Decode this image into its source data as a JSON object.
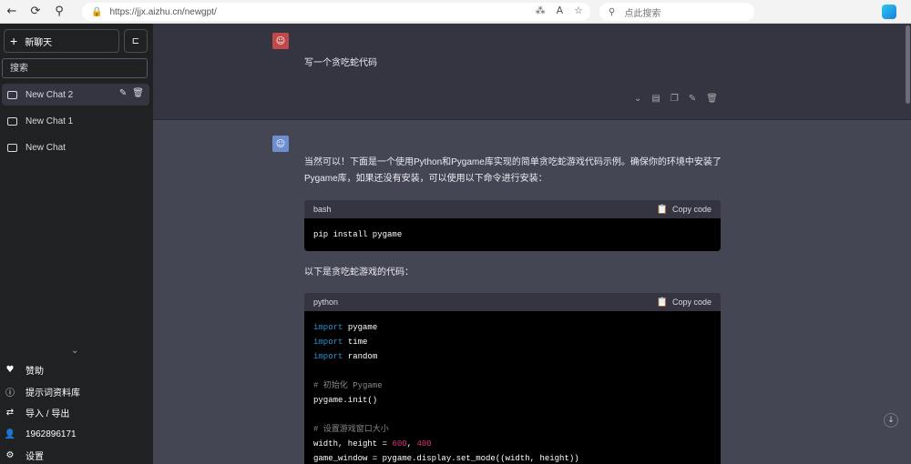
{
  "browser": {
    "url": "https://jjx.aizhu.cn/newgpt/",
    "search_placeholder": "点此搜索"
  },
  "sidebar": {
    "new_chat_label": "新聊天",
    "search_placeholder": "搜索",
    "chats": [
      {
        "label": "New Chat 2",
        "active": true
      },
      {
        "label": "New Chat 1",
        "active": false
      },
      {
        "label": "New Chat",
        "active": false
      }
    ],
    "bottom_items": [
      {
        "label": "赞助",
        "icon": "heart-icon"
      },
      {
        "label": "提示词资料库",
        "icon": "info-icon"
      },
      {
        "label": "导入 / 导出",
        "icon": "import-export-icon"
      },
      {
        "label": "1962896171",
        "icon": "user-icon"
      },
      {
        "label": "设置",
        "icon": "gear-icon"
      }
    ]
  },
  "conversation": {
    "user_message": "写一个贪吃蛇代码",
    "bot_intro": "当然可以！下面是一个使用Python和Pygame库实现的简单贪吃蛇游戏代码示例。确保你的环境中安装了Pygame库，如果还没有安装，可以使用以下命令进行安装：",
    "code1": {
      "lang": "bash",
      "copy_label": "Copy code",
      "line": "pip install pygame"
    },
    "bot_middle": "以下是贪吃蛇游戏的代码：",
    "code2": {
      "lang": "python",
      "copy_label": "Copy code",
      "kw_import": "import",
      "mod1": "pygame",
      "mod2": "time",
      "mod3": "random",
      "comment1": "# 初始化 Pygame",
      "init_line": "pygame.init()",
      "comment2": "# 设置游戏窗口大小",
      "wh_prefix": "width, height = ",
      "width_val": "600",
      "height_val": "400",
      "last_line": "game_window = pygame.display.set_mode((width, height))"
    }
  }
}
